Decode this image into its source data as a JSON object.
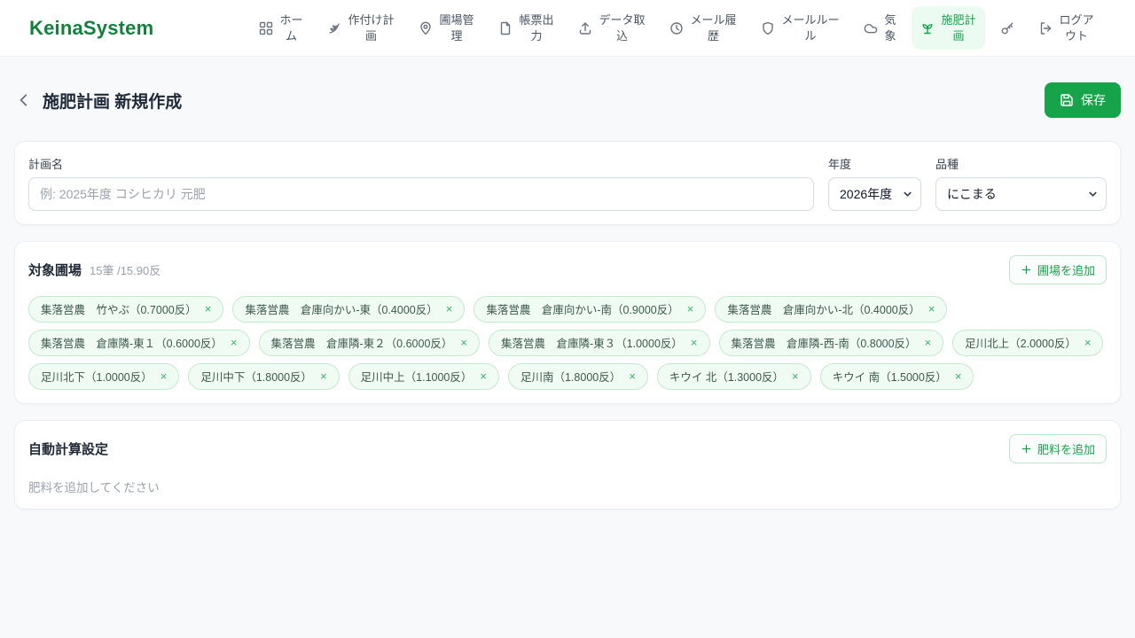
{
  "brand": "KeinaSystem",
  "colors": {
    "accent": "#16a34a",
    "accent_dark": "#15803d",
    "active_nav_bg": "#ecfbf1",
    "chip_bg": "#f0fbf4"
  },
  "nav": {
    "items": [
      {
        "label": "ホーム",
        "icon": "grid-icon",
        "active": false
      },
      {
        "label": "作付け計画",
        "icon": "wheat-icon",
        "active": false
      },
      {
        "label": "圃場管理",
        "icon": "map-pin-icon",
        "active": false
      },
      {
        "label": "帳票出力",
        "icon": "document-icon",
        "active": false
      },
      {
        "label": "データ取込",
        "icon": "upload-icon",
        "active": false
      },
      {
        "label": "メール履歴",
        "icon": "history-icon",
        "active": false
      },
      {
        "label": "メールルール",
        "icon": "shield-icon",
        "active": false
      },
      {
        "label": "気象",
        "icon": "cloud-icon",
        "active": false
      },
      {
        "label": "施肥計画",
        "icon": "sprout-icon",
        "active": true
      },
      {
        "label": "",
        "icon": "key-icon",
        "active": false
      },
      {
        "label": "ログアウト",
        "icon": "logout-icon",
        "active": false
      }
    ]
  },
  "page": {
    "title": "施肥計画 新規作成",
    "save_label": "保存",
    "save_icon": "save-icon",
    "back_icon": "chevron-left-icon"
  },
  "form": {
    "plan_name": {
      "label": "計画名",
      "placeholder": "例: 2025年度 コシヒカリ 元肥",
      "value": ""
    },
    "year": {
      "label": "年度",
      "value": "2026年度"
    },
    "variety": {
      "label": "品種",
      "value": "にこまる"
    }
  },
  "fields_section": {
    "title": "対象圃場",
    "summary": "15筆 /15.90反",
    "add_button_label": "圃場を追加",
    "add_button_icon": "plus-icon",
    "chip_close": "×",
    "chips": [
      {
        "label": "集落営農　竹やぶ（0.7000反）"
      },
      {
        "label": "集落営農　倉庫向かい-東（0.4000反）"
      },
      {
        "label": "集落営農　倉庫向かい-南（0.9000反）"
      },
      {
        "label": "集落営農　倉庫向かい-北（0.4000反）"
      },
      {
        "label": "集落営農　倉庫隣-東１（0.6000反）"
      },
      {
        "label": "集落営農　倉庫隣-東２（0.6000反）"
      },
      {
        "label": "集落営農　倉庫隣-東３（1.0000反）"
      },
      {
        "label": "集落営農　倉庫隣-西-南（0.8000反）"
      },
      {
        "label": "足川北上（2.0000反）"
      },
      {
        "label": "足川北下（1.0000反）"
      },
      {
        "label": "足川中下（1.8000反）"
      },
      {
        "label": "足川中上（1.1000反）"
      },
      {
        "label": "足川南（1.8000反）"
      },
      {
        "label": "キウイ 北（1.3000反）"
      },
      {
        "label": "キウイ 南（1.5000反）"
      }
    ]
  },
  "auto_calc": {
    "title": "自動計算設定",
    "add_button_label": "肥料を追加",
    "add_button_icon": "plus-icon",
    "empty_message": "肥料を追加してください"
  }
}
